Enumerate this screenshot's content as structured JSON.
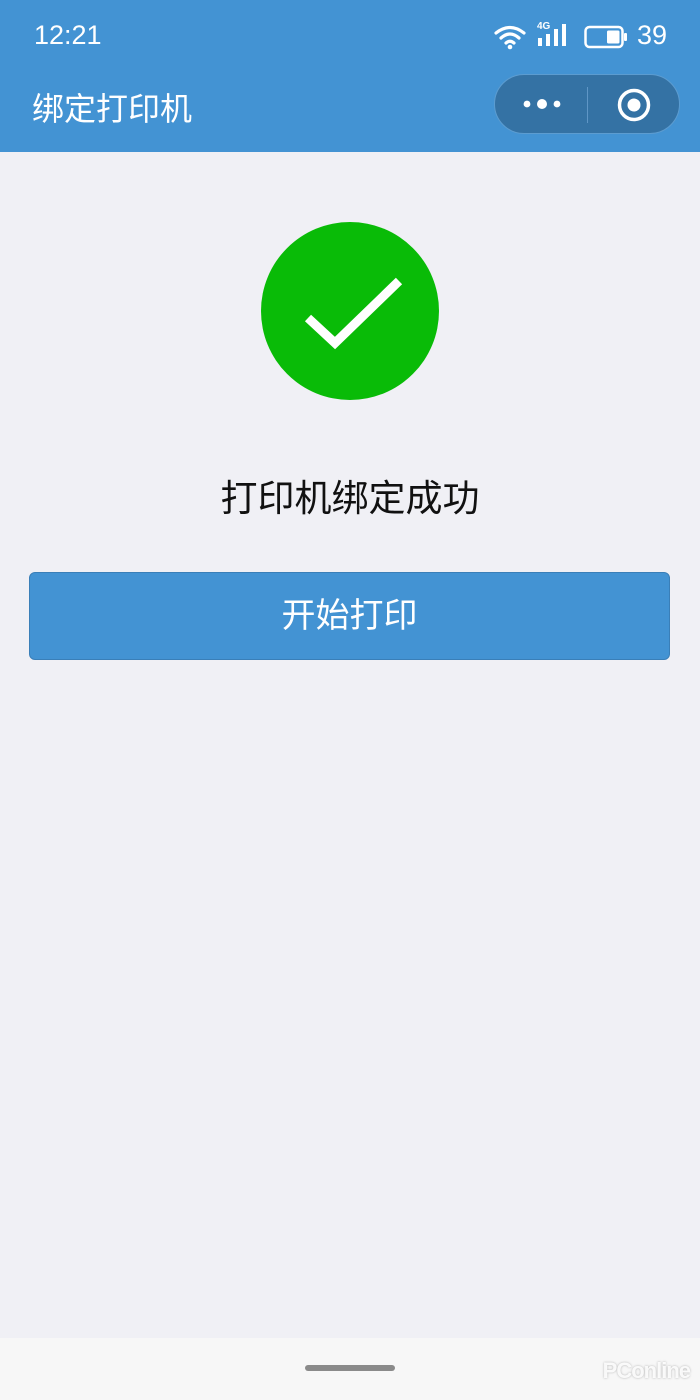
{
  "status_bar": {
    "time": "12:21",
    "network_type": "4G",
    "battery_level": "39"
  },
  "nav": {
    "title": "绑定打印机"
  },
  "main": {
    "success_message": "打印机绑定成功",
    "start_button_label": "开始打印"
  },
  "watermark": "PConline",
  "colors": {
    "header": "#4393D3",
    "success": "#09BB07",
    "background": "#F0F0F5",
    "button": "#4393D3"
  },
  "icons": {
    "status": [
      "wifi-icon",
      "signal-icon",
      "battery-icon"
    ],
    "capsule": [
      "more-icon",
      "close-icon"
    ],
    "result": "check-icon"
  }
}
